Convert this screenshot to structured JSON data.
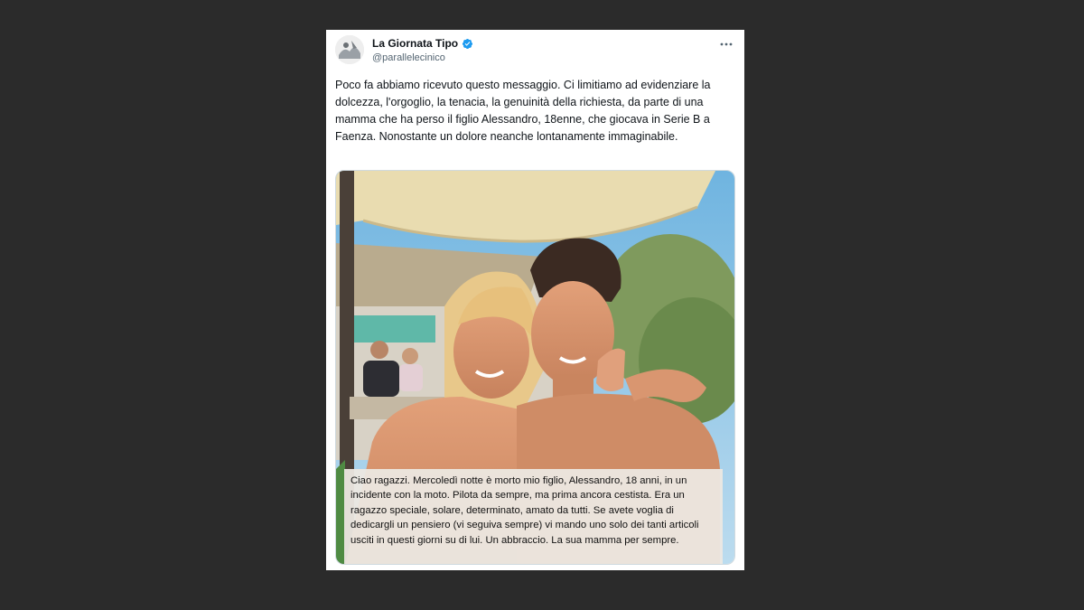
{
  "tweet": {
    "display_name": "La Giornata Tipo",
    "handle": "@parallelecinico",
    "verified": true,
    "more_icon": "more-horizontal-icon",
    "text": "Poco fa abbiamo ricevuto questo messaggio. Ci limitiamo ad evidenziare la dolcezza, l'orgoglio, la tenacia, la genuinità della richiesta, da parte di una mamma che ha perso il figlio Alessandro, 18enne, che giocava in Serie B a Faenza. Nonostante un dolore neanche lontanamente immaginabile.",
    "image_caption": "Ciao ragazzi. Mercoledì notte è morto mio figlio, Alessandro, 18 anni, in un incidente con la moto. Pilota da sempre, ma prima ancora cestista. Era un ragazzo speciale, solare, determinato, amato da tutti. Se avete voglia di dedicargli un pensiero (vi seguiva sempre) vi mando uno solo dei tanti articoli usciti in questi giorni su di lui. Un abbraccio. La sua mamma per sempre."
  },
  "colors": {
    "background": "#2b2b2b",
    "verified_badge": "#1d9bf0",
    "handle": "#536471"
  }
}
